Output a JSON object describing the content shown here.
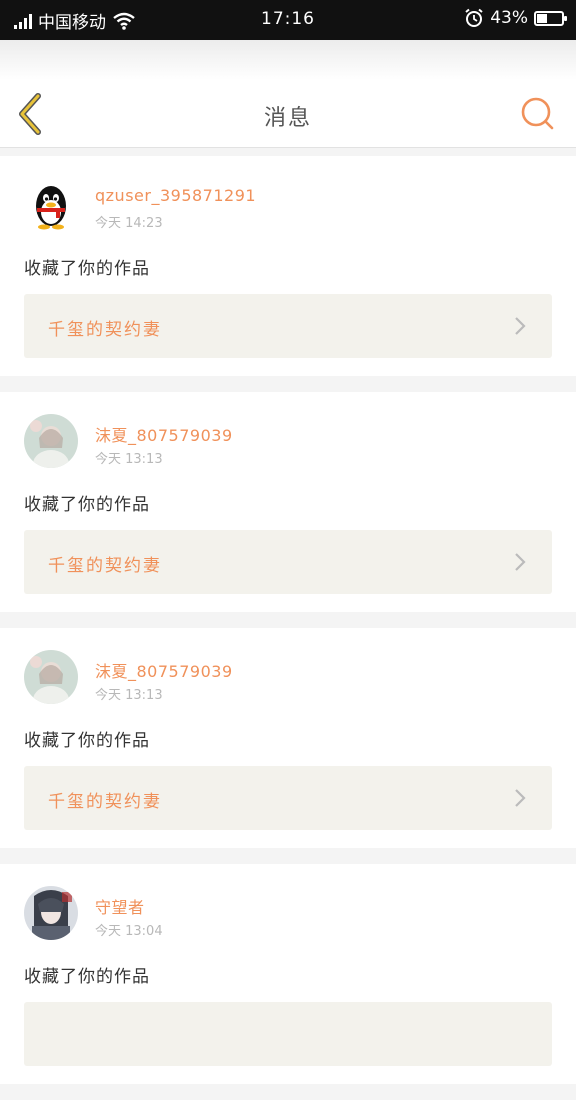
{
  "status_bar": {
    "carrier": "中国移动",
    "time": "17:16",
    "battery_text": "43%",
    "battery_level": 0.43
  },
  "header": {
    "title": "消息",
    "back_icon": "chevron-left-icon",
    "search_icon": "search-icon"
  },
  "colors": {
    "accent": "#f0915a",
    "back_accent": "#e8c33a",
    "card_link_bg": "#f3f2ec"
  },
  "messages": [
    {
      "username": "qzuser_395871291",
      "time": "今天 14:23",
      "action": "收藏了你的作品",
      "work_title": "千玺的契约妻",
      "avatar_icon": "qq-penguin-icon"
    },
    {
      "username": "沫夏_807579039",
      "time": "今天 13:13",
      "action": "收藏了你的作品",
      "work_title": "千玺的契约妻",
      "avatar_icon": "user-photo-avatar"
    },
    {
      "username": "沫夏_807579039",
      "time": "今天 13:13",
      "action": "收藏了你的作品",
      "work_title": "千玺的契约妻",
      "avatar_icon": "user-photo-avatar"
    },
    {
      "username": "守望者",
      "time": "今天 13:04",
      "action": "收藏了你的作品",
      "work_title": "",
      "avatar_icon": "anime-avatar"
    }
  ]
}
